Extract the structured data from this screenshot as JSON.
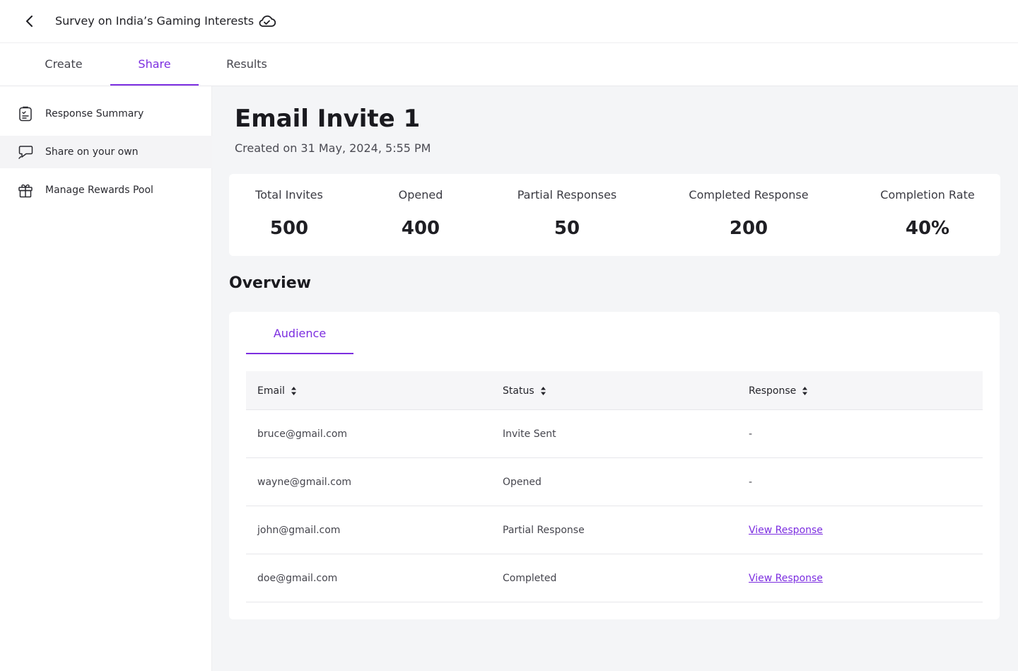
{
  "header": {
    "survey_title": "Survey on India’s Gaming Interests"
  },
  "tabs": [
    {
      "label": "Create"
    },
    {
      "label": "Share"
    },
    {
      "label": "Results"
    }
  ],
  "active_tab": "Share",
  "sidebar": {
    "items": [
      {
        "label": "Response Summary",
        "icon": "clipboard-icon"
      },
      {
        "label": "Share on your own",
        "icon": "megaphone-icon"
      },
      {
        "label": "Manage Rewards Pool",
        "icon": "gift-icon"
      }
    ],
    "active_item": "Share on your own"
  },
  "invite": {
    "title": "Email Invite 1",
    "created_on": "Created on 31 May, 2024, 5:55 PM"
  },
  "stats": [
    {
      "label": "Total Invites",
      "value": "500"
    },
    {
      "label": "Opened",
      "value": "400"
    },
    {
      "label": "Partial Responses",
      "value": "50"
    },
    {
      "label": "Completed Response",
      "value": "200"
    },
    {
      "label": "Completion Rate",
      "value": "40%"
    }
  ],
  "overview": {
    "title": "Overview",
    "tab_label": "Audience",
    "columns": [
      "Email",
      "Status",
      "Response"
    ],
    "rows": [
      {
        "email": "bruce@gmail.com",
        "status": "Invite Sent",
        "response": "-"
      },
      {
        "email": "wayne@gmail.com",
        "status": "Opened",
        "response": "-"
      },
      {
        "email": "john@gmail.com",
        "status": "Partial Response",
        "response": "View Response"
      },
      {
        "email": "doe@gmail.com",
        "status": "Completed",
        "response": "View Response"
      }
    ]
  },
  "colors": {
    "accent": "#7c2ee0",
    "main_bg": "#f4f5f7",
    "sidebar_active_bg": "#f4f4f6"
  }
}
